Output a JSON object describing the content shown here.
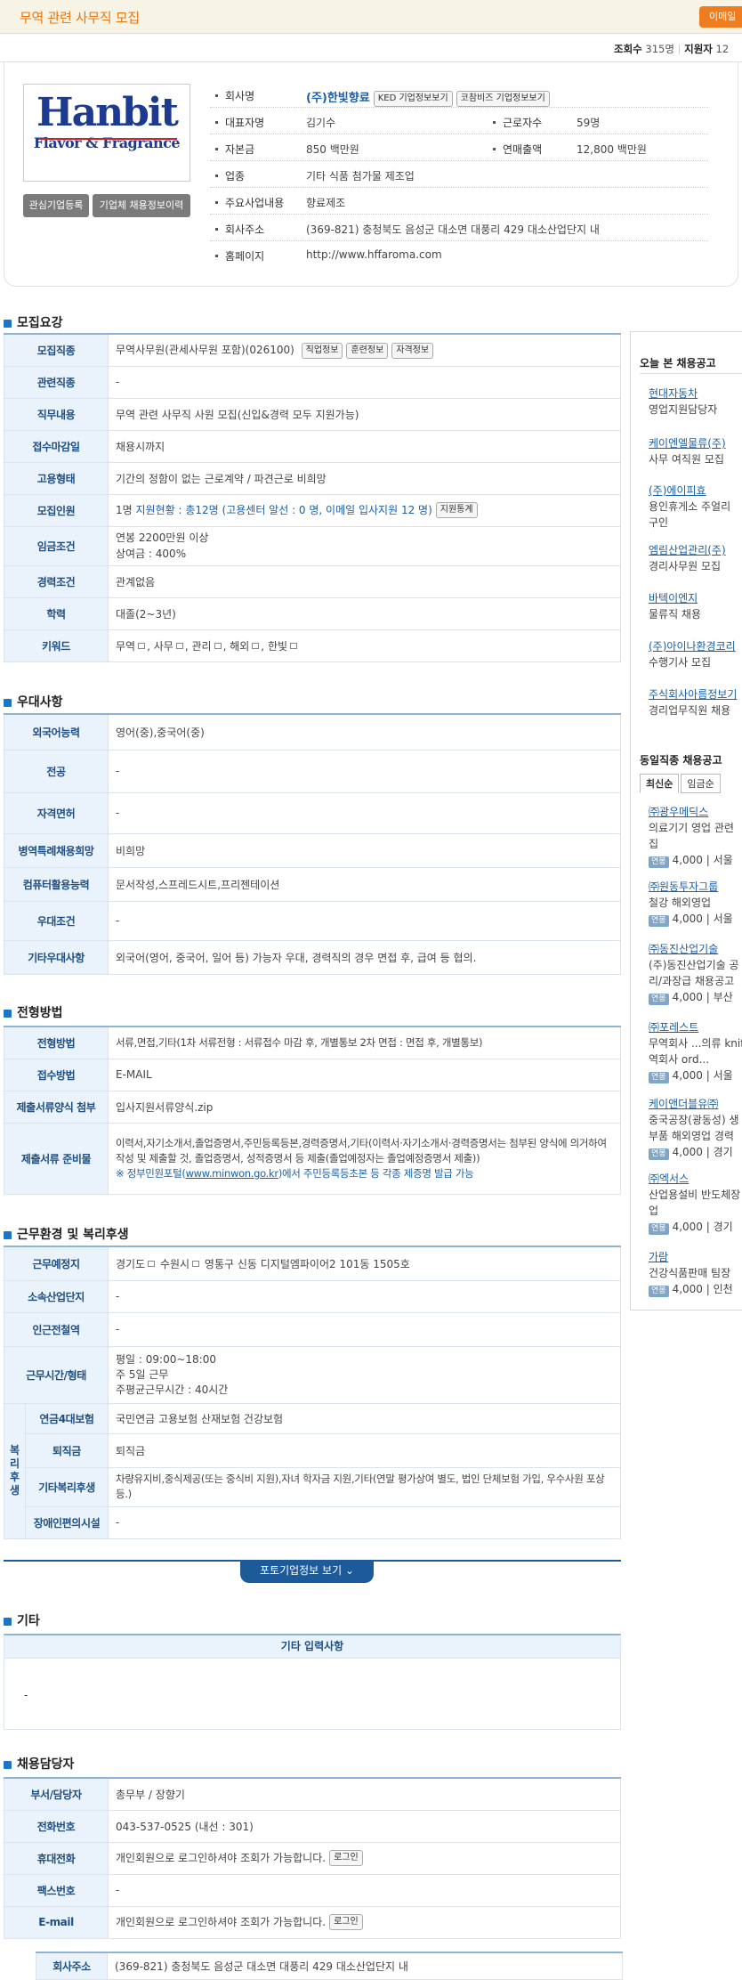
{
  "header": {
    "title": "무역 관련 사무직 모집",
    "mail_button": "이메일",
    "views_label": "조회수",
    "views": "315명",
    "applicants_label": "지원자",
    "applicants": "12"
  },
  "company": {
    "logo": {
      "word": "Hanbit",
      "tagline": "Flavor & Fragrance"
    },
    "interest_button": "관심기업등록",
    "history_button": "기업체 채용정보이력",
    "name_label": "회사명",
    "name": "(주)한빛향료",
    "ked_button": "KED 기업정보보기",
    "corbiz_button": "코참비즈 기업정보보기",
    "ceo_label": "대표자명",
    "ceo": "김기수",
    "employees_label": "근로자수",
    "employees": "59명",
    "capital_label": "자본금",
    "capital": "850 백만원",
    "sales_label": "연매출액",
    "sales": "12,800 백만원",
    "industry_label": "업종",
    "industry": "기타 식품 첨가물 제조업",
    "business_label": "주요사업내용",
    "business": "향료제조",
    "address_label": "회사주소",
    "address": "(369-821) 충청북도 음성군 대소면 대풍리 429 대소산업단지 내",
    "homepage_label": "홈페이지",
    "homepage": "http://www.hffaroma.com"
  },
  "recruit": {
    "title": "모집요강",
    "rows": [
      {
        "k": "모집직종",
        "v": "무역사무원(관세사무원 포함)(026100)",
        "btns": [
          "직업정보",
          "훈련정보",
          "자격정보"
        ]
      },
      {
        "k": "관련직종",
        "v": "-"
      },
      {
        "k": "직무내용",
        "v": "무역 관련 사무직 사원 모집(신입&경력 모두 지원가능)"
      },
      {
        "k": "접수마감일",
        "v": "채용시까지"
      },
      {
        "k": "고용형태",
        "v": "기간의 정함이 없는 근로계약 / 파견근로 비희망"
      },
      {
        "k": "모집인원",
        "v": "1명",
        "v2": "지원현황 : 총12명 (고용센터 알선 : 0 명, 이메일 입사지원 12 명)",
        "btn": "지원통계"
      },
      {
        "k": "임금조건",
        "v": "연봉 2200만원 이상",
        "v2": "상여금 : 400%"
      },
      {
        "k": "경력조건",
        "v": "관계없음"
      },
      {
        "k": "학력",
        "v": "대졸(2~3년)"
      },
      {
        "k": "키워드",
        "kw": [
          "무역",
          "사무",
          "관리",
          "해외",
          "한빛"
        ]
      }
    ]
  },
  "pref": {
    "title": "우대사항",
    "rows": [
      {
        "k": "외국어능력",
        "v": "영어(중),중국어(중)"
      },
      {
        "k": "전공",
        "v": "-"
      },
      {
        "k": "자격면허",
        "v": "-"
      },
      {
        "k": "병역특례채용희망",
        "v": "비희망"
      },
      {
        "k": "컴퓨터활용능력",
        "v": "문서작성,스프레드시트,프리젠테이션"
      },
      {
        "k": "우대조건",
        "v": "-"
      },
      {
        "k": "기타우대사항",
        "v": "외국어(영어, 중국어, 일어 등) 가능자 우대, 경력직의 경우 면접 후, 급여 등 협의."
      }
    ]
  },
  "screen": {
    "title": "전형방법",
    "rows": [
      {
        "k": "전형방법",
        "v": "서류,면접,기타(1차 서류전형 : 서류접수 마감 후, 개별통보 2차 면접 : 면접 후, 개별통보)"
      },
      {
        "k": "접수방법",
        "v": "E-MAIL"
      },
      {
        "k": "제출서류양식 첨부",
        "v": "입사지원서류양식.zip"
      },
      {
        "k": "제출서류 준비물",
        "v": "이력서,자기소개서,졸업증명서,주민등록등본,경력증명서,기타(이력서·자기소개서·경력증명서는 첨부된 양식에 의거하여 작성 및 제출할 것, 졸업증명서, 성적증명서 등 제출(졸업예정자는 졸업예정증명서 제출))",
        "note_pre": "※ 정부민원포털(",
        "note_link": "www.minwon.go.kr",
        "note_post": ")에서 주민등록등초본 등 각종 제증명 발급 가능"
      }
    ]
  },
  "welfare": {
    "title": "근무환경 및 복리후생",
    "loc_label": "근무예정지",
    "loc": [
      "경기도",
      "수원시",
      "영통구 신동 디지털엠파이어2 101동 1505호"
    ],
    "ind_label": "소속산업단지",
    "ind": "-",
    "station_label": "인근전철역",
    "station": "-",
    "hours_label": "근무시간/형태",
    "hours": [
      "평일 : 09:00~18:00",
      "주 5일 근무",
      "주평균근무시간 : 40시간"
    ],
    "group_label": [
      "복",
      "리",
      "후",
      "생"
    ],
    "ins_label": "연금4대보험",
    "ins": "국민연금 고용보험 산재보험 건강보험",
    "sev_label": "퇴직금",
    "sev": "퇴직금",
    "etc_label": "기타복리후생",
    "etc": "차량유지비,중식제공(또는 중식비 지원),자녀 학자금 지원,기타(연말 평가상여 별도, 법인 단체보험 가입, 우수사원 포상 등.)",
    "dis_label": "장애인편의시설",
    "dis": "-"
  },
  "more_button": "포토기업정보 보기",
  "other": {
    "title": "기타",
    "head": "기타 입력사항",
    "body": "-"
  },
  "manager": {
    "title": "채용담당자",
    "rows": [
      {
        "k": "부서/담당자",
        "v": "총무부 / 장향기"
      },
      {
        "k": "전화번호",
        "v": "043-537-0525 (내선 : 301)"
      },
      {
        "k": "휴대전화",
        "v": "개인회원으로 로그인하셔야 조회가 가능합니다.",
        "btn": "로그인"
      },
      {
        "k": "팩스번호",
        "v": "-"
      },
      {
        "k": "E-mail",
        "v": "개인회원으로 로그인하셔야 조회가 가능합니다.",
        "btn": "로그인"
      }
    ],
    "addr_label": "회사주소",
    "addr": "(369-821) 충청북도 음성군 대소면 대풍리 429 대소산업단지 내"
  },
  "sidebar": {
    "today_title": "오늘 본 채용공고",
    "today": [
      {
        "n": "현대자동차",
        "d": "영업지원담당자"
      },
      {
        "n": "케이엔엘물류(주)",
        "d": "사무 여직원 모집"
      },
      {
        "n": "(주)에이피효",
        "d": "용인휴게소 주얼리",
        "d2": "구인"
      },
      {
        "n": "엠림산업관리(주)",
        "d": "경리사무원 모집"
      },
      {
        "n": "바텍이엔지",
        "d": "물류직 채용"
      },
      {
        "n": "(주)아이나환경코리",
        "d": "수행기사 모집"
      },
      {
        "n": "주식회사아름정보기",
        "d": "경리업무직원 채용"
      }
    ],
    "same_title": "동일직종 채용공고",
    "tabs": [
      "최신순",
      "임금순"
    ],
    "same": [
      {
        "n": "㈜광우메딕스",
        "d": "의료기기 영업 관련",
        "d2": "집",
        "badge": "연봉",
        "pay": "4,000",
        "loc": "서울"
      },
      {
        "n": "㈜원동투자그룹",
        "d": "철강 해외영업",
        "badge": "연봉",
        "pay": "4,000",
        "loc": "서울"
      },
      {
        "n": "㈜동진산업기술",
        "d": "(주)동진산업기술 공",
        "d2": "리/과장급 채용공고",
        "badge": "연봉",
        "pay": "4,000",
        "loc": "부산"
      },
      {
        "n": "㈜포레스트",
        "d": "무역회사 ...의류 knit",
        "d2": "역회사 ord...",
        "badge": "연봉",
        "pay": "4,000",
        "loc": "서울"
      },
      {
        "n": "케이앤더블유㈜",
        "d": "중국공장(광동성) 생",
        "d2": "부품 해외영업 경력",
        "badge": "연봉",
        "pay": "4,000",
        "loc": "경기"
      },
      {
        "n": "㈜엑서스",
        "d": "산업용설비 반도체장",
        "d2": "업",
        "badge": "연봉",
        "pay": "4,000",
        "loc": "경기"
      },
      {
        "n": "가람",
        "d": "건강식품판매 팀장",
        "badge": "연봉",
        "pay": "4,000",
        "loc": "인천"
      }
    ]
  }
}
